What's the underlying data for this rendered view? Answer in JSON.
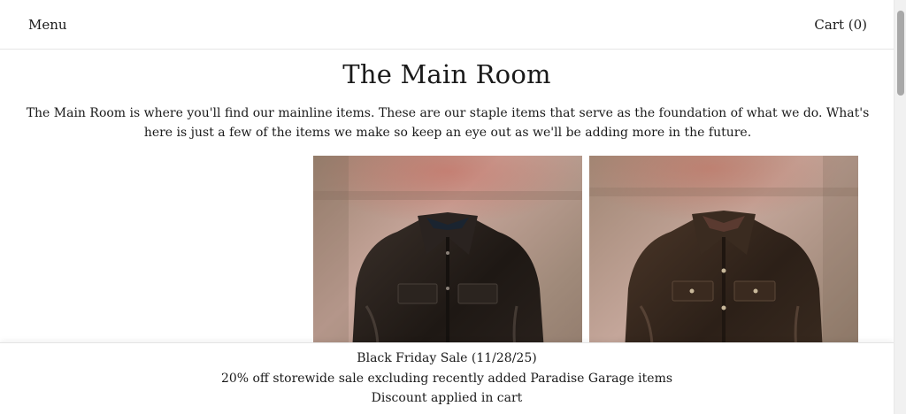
{
  "header": {
    "menu_label": "Menu",
    "cart_label": "Cart (0)"
  },
  "main": {
    "title": "The Main Room",
    "intro": "The Main Room is where you'll find our mainline items.  These are our staple items that serve as the foundation of what we do.  What's here is just a few of the items we make so keep an eye out as we'll be adding more in the future."
  },
  "products": [
    {
      "image_icon": "black-leather-jacket-image",
      "jacket_color": "#2a221d"
    },
    {
      "image_icon": "brown-leather-jacket-image",
      "jacket_color": "#3a2a20"
    }
  ],
  "banner": {
    "line1": "Black Friday Sale (11/28/25)",
    "line2": "20% off storewide sale excluding recently added Paradise Garage items",
    "line3": "Discount applied in cart"
  },
  "colors": {
    "background": "#ffffff",
    "text": "#1a1a1a",
    "backdrop": "#b89a8a"
  }
}
